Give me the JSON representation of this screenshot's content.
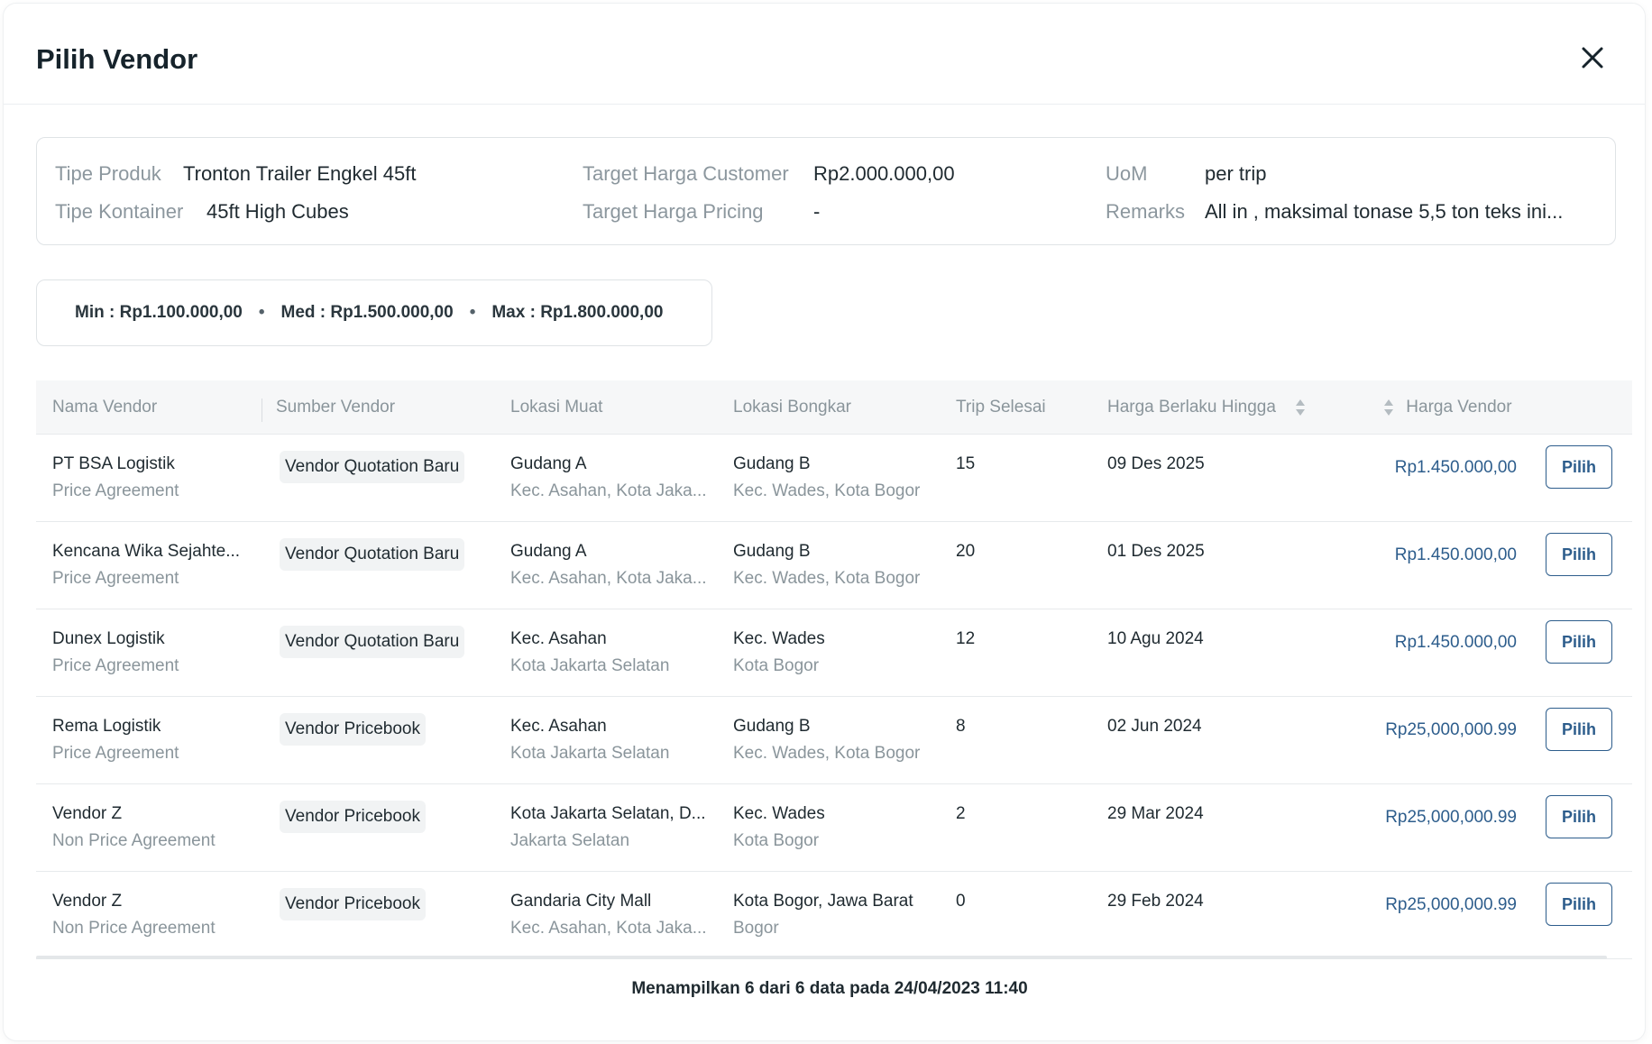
{
  "modal": {
    "title": "Pilih Vendor"
  },
  "info": {
    "tipe_produk_label": "Tipe Produk",
    "tipe_produk_value": "Tronton Trailer Engkel 45ft",
    "tipe_kontainer_label": "Tipe Kontainer",
    "tipe_kontainer_value": "45ft High Cubes",
    "target_customer_label": "Target Harga Customer",
    "target_customer_value": "Rp2.000.000,00",
    "target_pricing_label": "Target Harga Pricing",
    "target_pricing_value": "-",
    "uom_label": "UoM",
    "uom_value": "per trip",
    "remarks_label": "Remarks",
    "remarks_value": "All in , maksimal tonase 5,5 ton teks ini..."
  },
  "stats": {
    "min": "Min :  Rp1.100.000,00",
    "med": "Med : Rp1.500.000,00",
    "max": "Max : Rp1.800.000,00",
    "separator": "•"
  },
  "table": {
    "headers": {
      "nama_vendor": "Nama Vendor",
      "sumber_vendor": "Sumber Vendor",
      "lokasi_muat": "Lokasi Muat",
      "lokasi_bongkar": "Lokasi Bongkar",
      "trip_selesai": "Trip Selesai",
      "harga_berlaku": "Harga Berlaku Hingga",
      "harga_vendor": "Harga Vendor"
    },
    "rows": [
      {
        "vendor": "PT BSA Logistik",
        "vendor_type": "Price Agreement",
        "source": "Vendor Quotation Baru",
        "muat": "Gudang A",
        "muat_sub": "Kec. Asahan, Kota Jaka...",
        "bongkar": "Gudang B",
        "bongkar_sub": "Kec. Wades, Kota Bogor",
        "trips": "15",
        "valid_until": "09 Des 2025",
        "price": "Rp1.450.000,00",
        "action": "Pilih"
      },
      {
        "vendor": " Kencana Wika Sejahte...",
        "vendor_type": "Price Agreement",
        "source": "Vendor Quotation Baru",
        "muat": "Gudang A",
        "muat_sub": "Kec. Asahan, Kota Jaka...",
        "bongkar": "Gudang B",
        "bongkar_sub": "Kec. Wades, Kota Bogor",
        "trips": "20",
        "valid_until": "01 Des 2025",
        "price": "Rp1.450.000,00",
        "action": "Pilih"
      },
      {
        "vendor": "Dunex Logistik",
        "vendor_type": "Price Agreement",
        "source": "Vendor Quotation Baru",
        "muat": "Kec. Asahan",
        "muat_sub": "Kota Jakarta Selatan",
        "bongkar": "Kec. Wades",
        "bongkar_sub": "Kota Bogor",
        "trips": "12",
        "valid_until": "10 Agu 2024",
        "price": "Rp1.450.000,00",
        "action": "Pilih"
      },
      {
        "vendor": "Rema Logistik",
        "vendor_type": "Price Agreement",
        "source": "Vendor Pricebook",
        "muat": "Kec. Asahan",
        "muat_sub": "Kota Jakarta Selatan",
        "bongkar": "Gudang B",
        "bongkar_sub": "Kec. Wades, Kota Bogor",
        "trips": "8",
        "valid_until": "02 Jun 2024",
        "price": "Rp25,000,000.99",
        "action": "Pilih"
      },
      {
        "vendor": "Vendor Z",
        "vendor_type": "Non Price Agreement",
        "source": "Vendor Pricebook",
        "muat": "Kota Jakarta Selatan, D...",
        "muat_sub": "Jakarta Selatan",
        "bongkar": "Kec. Wades",
        "bongkar_sub": "Kota Bogor",
        "trips": "2",
        "valid_until": "29 Mar 2024",
        "price": "Rp25,000,000.99",
        "action": "Pilih"
      },
      {
        "vendor": "Vendor Z",
        "vendor_type": "Non Price Agreement",
        "source": "Vendor Pricebook",
        "muat": "Gandaria City Mall",
        "muat_sub": "Kec. Asahan, Kota Jaka...",
        "bongkar": "Kota Bogor, Jawa Barat",
        "bongkar_sub": "Bogor",
        "trips": "0",
        "valid_until": "29 Feb 2024",
        "price": "Rp25,000,000.99",
        "action": "Pilih"
      }
    ]
  },
  "footer": {
    "summary": "Menampilkan 6 dari 6 data pada 24/04/2023 11:40"
  },
  "colors": {
    "accent": "#2d5d8c",
    "muted": "#8a959b",
    "text": "#1f2a30"
  }
}
